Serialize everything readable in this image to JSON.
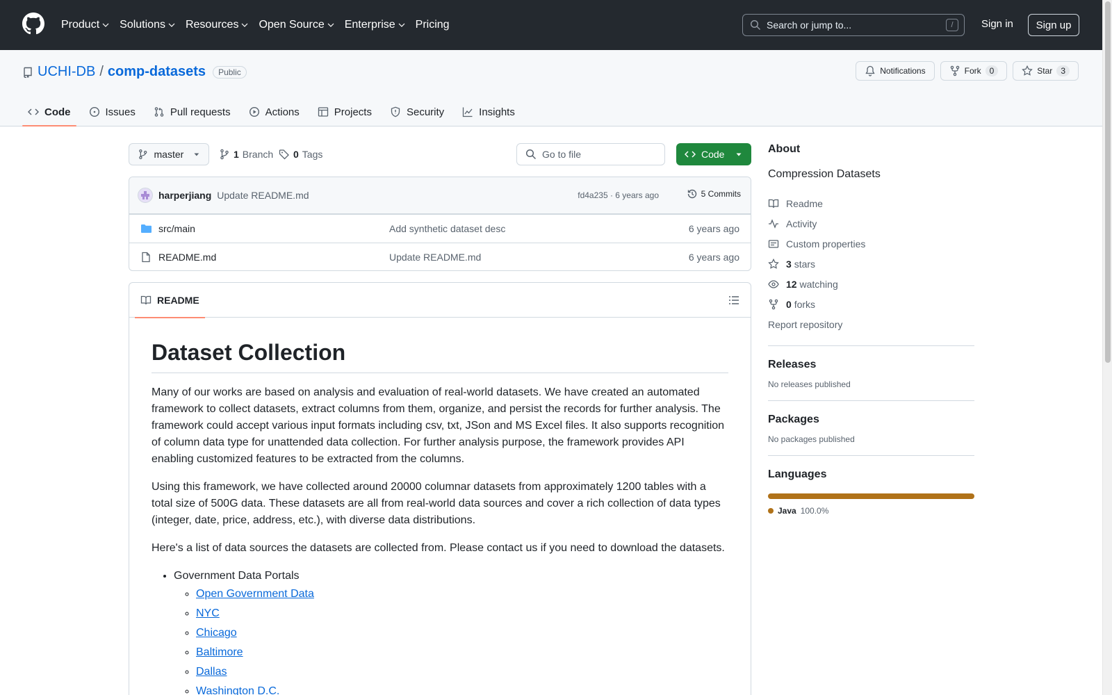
{
  "header": {
    "nav": [
      "Product",
      "Solutions",
      "Resources",
      "Open Source",
      "Enterprise",
      "Pricing"
    ],
    "search_placeholder": "Search or jump to...",
    "search_shortcut": "/",
    "sign_in": "Sign in",
    "sign_up": "Sign up"
  },
  "repo": {
    "owner": "UCHI-DB",
    "separator": "/",
    "name": "comp-datasets",
    "visibility": "Public",
    "notifications_label": "Notifications",
    "fork_label": "Fork",
    "fork_count": "0",
    "star_label": "Star",
    "star_count": "3",
    "tabs": [
      "Code",
      "Issues",
      "Pull requests",
      "Actions",
      "Projects",
      "Security",
      "Insights"
    ]
  },
  "toolbar": {
    "branch": "master",
    "branch_count": "1",
    "branch_label": "Branch",
    "tag_count": "0",
    "tag_label": "Tags",
    "goto_placeholder": "Go to file",
    "code_label": "Code"
  },
  "commit": {
    "author": "harperjiang",
    "message": "Update README.md",
    "meta": "fd4a235 · 6 years ago",
    "count_label": "5 Commits"
  },
  "files": [
    {
      "name": "src/main",
      "type": "folder",
      "commit": "Add synthetic dataset desc",
      "age": "6 years ago"
    },
    {
      "name": "README.md",
      "type": "file",
      "commit": "Update README.md",
      "age": "6 years ago"
    }
  ],
  "readme": {
    "tab_label": "README",
    "title": "Dataset Collection",
    "paragraphs": [
      "Many of our works are based on analysis and evaluation of real-world datasets. We have created an automated framework to collect datasets, extract columns from them, organize, and persist the records for further analysis. The framework could accept various input formats including csv, txt, JSon and MS Excel files. It also supports recognition of column data type for unattended data collection. For further analysis purpose, the framework provides API enabling customized features to be extracted from the columns.",
      "Using this framework, we have collected around 20000 columnar datasets from approximately 1200 tables with a total size of 500G data. These datasets are all from real-world data sources and cover a rich collection of data types (integer, date, price, address, etc.), with diverse data distributions.",
      "Here's a list of data sources the datasets are collected from. Please contact us if you need to download the datasets."
    ],
    "list_heading": "Government Data Portals",
    "links": [
      "Open Government Data",
      "NYC",
      "Chicago",
      "Baltimore",
      "Dallas",
      "Washington D.C."
    ]
  },
  "sidebar": {
    "about_title": "About",
    "description": "Compression Datasets",
    "readme": "Readme",
    "activity": "Activity",
    "custom_properties": "Custom properties",
    "stars_count": "3",
    "stars_label": "stars",
    "watching_count": "12",
    "watching_label": "watching",
    "forks_count": "0",
    "forks_label": "forks",
    "report": "Report repository",
    "releases_title": "Releases",
    "releases_text": "No releases published",
    "packages_title": "Packages",
    "packages_text": "No packages published",
    "languages_title": "Languages",
    "language_name": "Java",
    "language_pct": "100.0%",
    "language_color": "#b07219"
  }
}
